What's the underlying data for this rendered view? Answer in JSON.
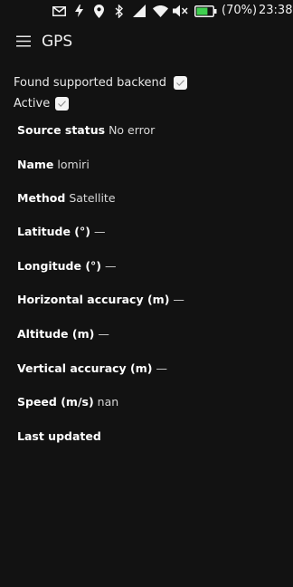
{
  "status_bar": {
    "battery_percent": "(70%)",
    "time": "23:38",
    "icons": [
      "mail-icon",
      "flash-icon",
      "location-pin-icon",
      "bluetooth-icon",
      "cellular-signal-icon",
      "wifi-icon",
      "volume-muted-icon",
      "battery-icon"
    ],
    "battery_level": 0.7,
    "battery_color": "#3fcf4f"
  },
  "header": {
    "title": "GPS",
    "menu_icon": "hamburger-menu-icon"
  },
  "checks": {
    "backend_label": "Found supported backend",
    "backend_checked": true,
    "active_label": "Active",
    "active_checked": true
  },
  "info": [
    {
      "label": "Source status",
      "value": "No error"
    },
    {
      "label": "Name",
      "value": "lomiri"
    },
    {
      "label": "Method",
      "value": "Satellite"
    },
    {
      "label": "Latitude (°)",
      "value": "—"
    },
    {
      "label": "Longitude (°)",
      "value": "—"
    },
    {
      "label": "Horizontal accuracy (m)",
      "value": "—"
    },
    {
      "label": "Altitude (m)",
      "value": "—"
    },
    {
      "label": "Vertical accuracy (m)",
      "value": "—"
    },
    {
      "label": "Speed (m/s)",
      "value": "nan"
    },
    {
      "label": "Last updated",
      "value": ""
    }
  ],
  "colors": {
    "background": "#121212",
    "text": "#ededed",
    "checkbox_fill": "#f4f4f4"
  }
}
